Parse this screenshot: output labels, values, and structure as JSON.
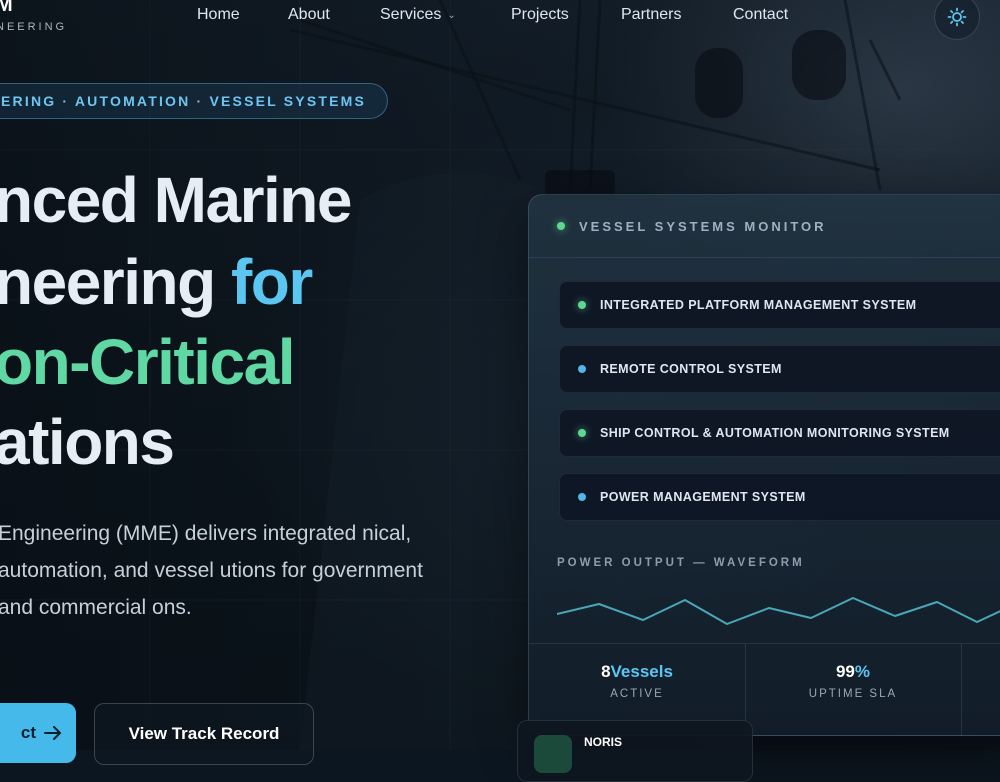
{
  "brand": {
    "mark": "M",
    "subtitle": "NEERING"
  },
  "nav": {
    "items": [
      {
        "label": "Home"
      },
      {
        "label": "About"
      },
      {
        "label": "Services",
        "dropdown": true
      },
      {
        "label": "Projects"
      },
      {
        "label": "Partners"
      },
      {
        "label": "Contact"
      }
    ],
    "theme_icon": "sun-icon"
  },
  "hero": {
    "tagline": "ERING · AUTOMATION · VESSEL SYSTEMS",
    "title_line1": "nced Marine",
    "title_line2_a": "neering ",
    "title_line2_b": "for",
    "title_line3": "on-Critical",
    "title_line4": "ations",
    "description": "Engineering (MME) delivers integrated nical, automation, and vessel utions for government and commercial ons.",
    "primary_button": "ct",
    "primary_icon": "arrow-right-icon",
    "secondary_button": "View Track Record"
  },
  "monitor": {
    "title": "VESSEL SYSTEMS MONITOR",
    "systems": [
      {
        "label": "INTEGRATED PLATFORM MANAGEMENT SYSTEM",
        "status": "green"
      },
      {
        "label": "REMOTE CONTROL SYSTEM",
        "status": "blue"
      },
      {
        "label": "SHIP CONTROL & AUTOMATION MONITORING SYSTEM",
        "status": "green"
      },
      {
        "label": "POWER MANAGEMENT SYSTEM",
        "status": "blue"
      }
    ],
    "waveform_label": "POWER OUTPUT — WAVEFORM",
    "stats": [
      {
        "value": "8",
        "accent": "Vessels",
        "label": "ACTIVE"
      },
      {
        "value": "99",
        "accent": "%",
        "label": "UPTIME SLA"
      }
    ]
  },
  "partner_card": {
    "name": "NORIS"
  },
  "colors": {
    "accent_blue": "#5cc6f2",
    "accent_green": "#5fd8a4",
    "status_green": "#5fd88f",
    "status_blue": "#52b6ea"
  }
}
